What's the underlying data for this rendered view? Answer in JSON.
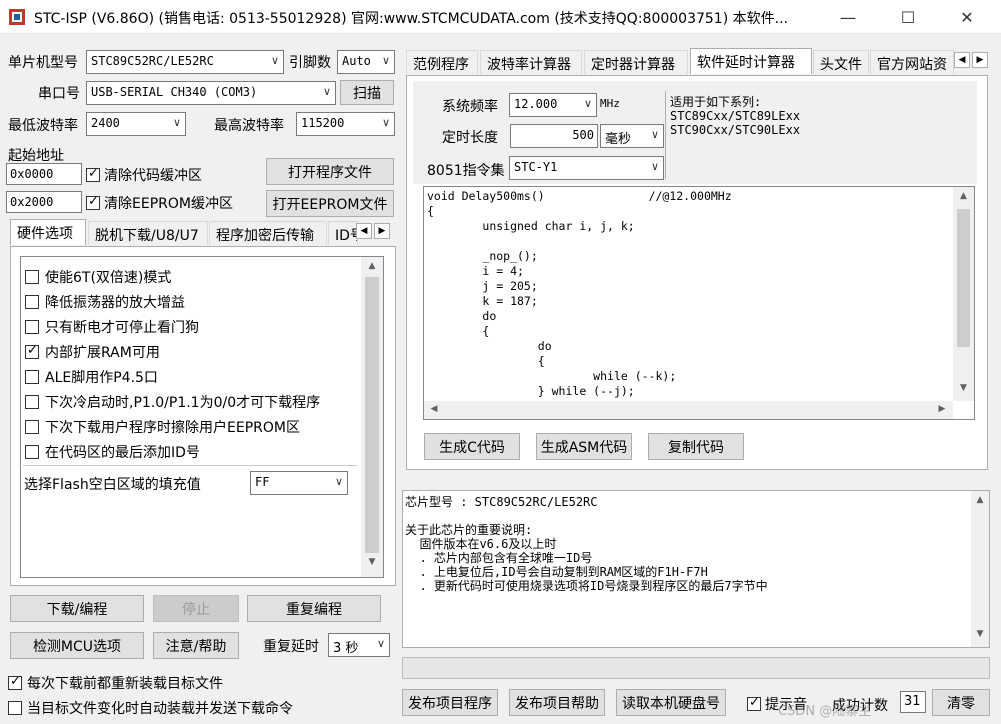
{
  "window": {
    "title": "STC-ISP (V6.86O) (销售电话: 0513-55012928) 官网:www.STCMCUDATA.com  (技术支持QQ:800003751) 本软件...",
    "min_glyph": "—",
    "max_glyph": "☐",
    "close_glyph": "✕"
  },
  "left": {
    "mcu_label": "单片机型号",
    "mcu_value": "STC89C52RC/LE52RC",
    "pins_label": "引脚数",
    "pins_value": "Auto",
    "port_label": "串口号",
    "port_value": "USB-SERIAL CH340 (COM3)",
    "scan_btn": "扫描",
    "min_baud_label": "最低波特率",
    "min_baud_value": "2400",
    "max_baud_label": "最高波特率",
    "max_baud_value": "115200",
    "start_addr_label": "起始地址",
    "addr1": "0x0000",
    "clear_code": "清除代码缓冲区",
    "open_prog": "打开程序文件",
    "addr2": "0x2000",
    "clear_eeprom": "清除EEPROM缓冲区",
    "open_eeprom": "打开EEPROM文件",
    "tabs": [
      "硬件选项",
      "脱机下载/U8/U7",
      "程序加密后传输",
      "ID号"
    ],
    "options": [
      {
        "label": "使能6T(双倍速)模式",
        "checked": false
      },
      {
        "label": "降低振荡器的放大增益",
        "checked": false
      },
      {
        "label": "只有断电才可停止看门狗",
        "checked": false
      },
      {
        "label": "内部扩展RAM可用",
        "checked": true
      },
      {
        "label": "ALE脚用作P4.5口",
        "checked": false
      },
      {
        "label": "下次冷启动时,P1.0/P1.1为0/0才可下载程序",
        "checked": false
      },
      {
        "label": "下次下载用户程序时擦除用户EEPROM区",
        "checked": false
      },
      {
        "label": "在代码区的最后添加ID号",
        "checked": false
      }
    ],
    "fill_label": "选择Flash空白区域的填充值",
    "fill_value": "FF",
    "download_btn": "下载/编程",
    "stop_btn": "停止",
    "reprog_btn": "重复编程",
    "detect_btn": "检测MCU选项",
    "help_btn": "注意/帮助",
    "repeat_delay_label": "重复延时",
    "repeat_delay_value": "3 秒",
    "reload_label": "每次下载前都重新装载目标文件",
    "reload_checked": true,
    "auto_label": "当目标文件变化时自动装载并发送下载命令",
    "auto_checked": false
  },
  "right": {
    "tabs": [
      "范例程序",
      "波特率计算器",
      "定时器计算器",
      "软件延时计算器",
      "头文件",
      "官方网站资"
    ],
    "active_tab": 3,
    "freq_label": "系统频率",
    "freq_value": "12.000",
    "freq_unit": "MHz",
    "dur_label": "定时长度",
    "dur_value": "500",
    "dur_unit": "毫秒",
    "isa_label": "8051指令集",
    "isa_value": "STC-Y1",
    "applies_title": "适用于如下系列:",
    "applies_lines": [
      "STC89Cxx/STC89LExx",
      "STC90Cxx/STC90LExx"
    ],
    "code_lines": [
      "void Delay500ms()\t\t//@12.000MHz",
      "{",
      "\tunsigned char i, j, k;",
      "",
      "\t_nop_();",
      "\ti = 4;",
      "\tj = 205;",
      "\tk = 187;",
      "\tdo",
      "\t{",
      "\t\tdo",
      "\t\t{",
      "\t\t\twhile (--k);",
      "\t\t} while (--j);"
    ],
    "gen_c": "生成C代码",
    "gen_asm": "生成ASM代码",
    "copy_code": "复制代码",
    "info_lines": [
      "芯片型号 : STC89C52RC/LE52RC",
      "",
      "关于此芯片的重要说明:",
      "  固件版本在v6.6及以上时",
      "  . 芯片内部包含有全球唯一ID号",
      "  . 上电复位后,ID号会自动复制到RAM区域的F1H-F7H",
      "  . 更新代码时可使用烧录选项将ID号烧录到程序区的最后7字节中"
    ],
    "publish_prog": "发布项目程序",
    "publish_help": "发布项目帮助",
    "read_disk": "读取本机硬盘号",
    "prompt_label": "提示音",
    "prompt_checked": true,
    "success_label": "成功计数",
    "success_value": "31",
    "clear_btn": "清零"
  },
  "watermark": "CSDN @陆寨主"
}
